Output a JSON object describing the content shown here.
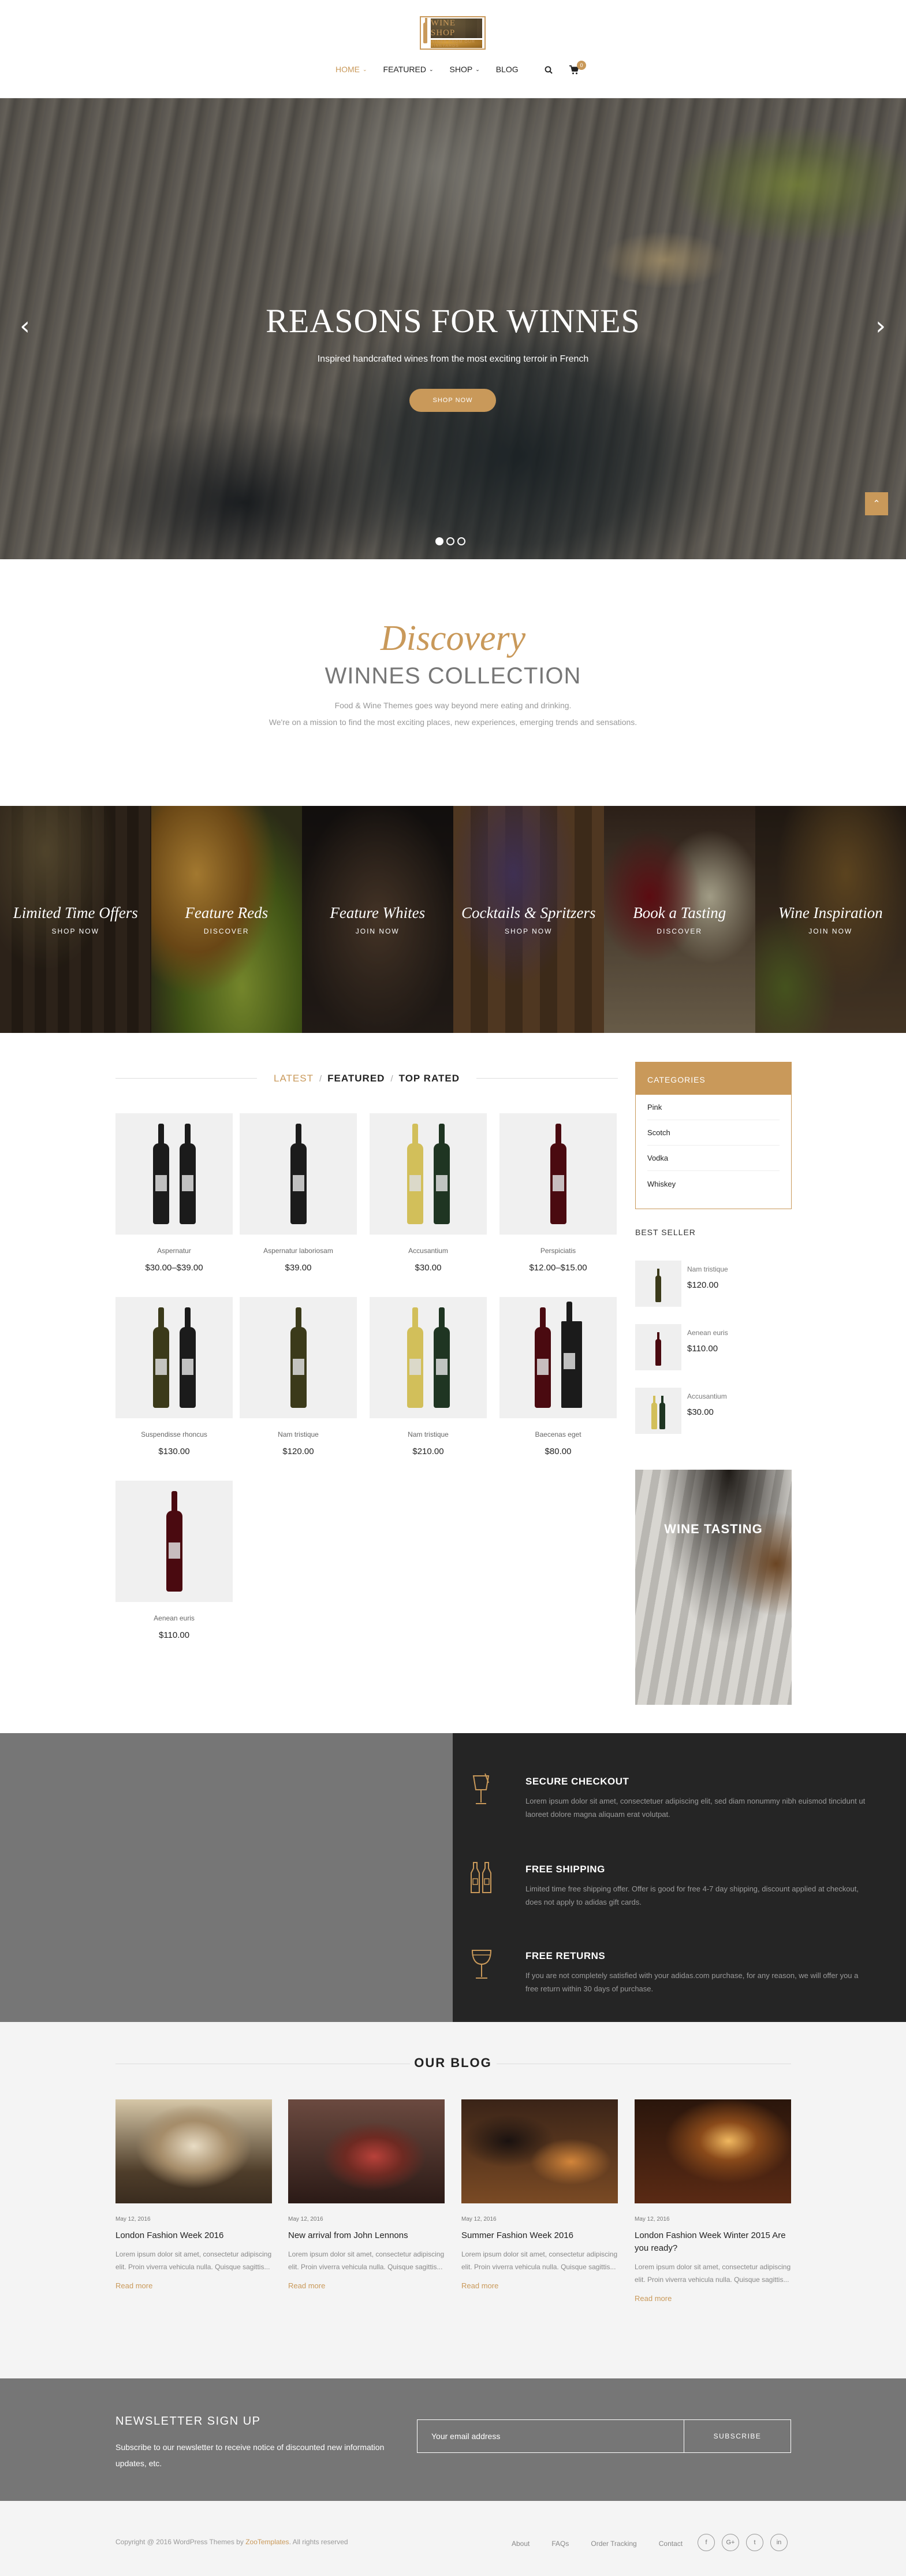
{
  "colors": {
    "accent": "#c9995a",
    "dark": "#252525",
    "gray": "#767676"
  },
  "header": {
    "logo_text": "WINE SHOP",
    "logo_tagline": "WINES FROM OUR VINEYARDS",
    "nav": [
      {
        "label": "HOME",
        "has_dropdown": true,
        "active": true
      },
      {
        "label": "FEATURED",
        "has_dropdown": true
      },
      {
        "label": "SHOP",
        "has_dropdown": true
      },
      {
        "label": "BLOG",
        "has_dropdown": false
      }
    ],
    "cart_count": "0"
  },
  "hero": {
    "title": "REASONS FOR WINNES",
    "subtitle": "Inspired handcrafted wines from the most exciting terroir in French",
    "button": "SHOP NOW",
    "prev": "‹",
    "next": "›",
    "back_to_top": "⌃"
  },
  "discovery": {
    "script": "Discovery",
    "title": "WINNES COLLECTION",
    "line1": "Food & Wine Themes goes way beyond mere eating and drinking.",
    "line2": "We're on a mission to find the most exciting places, new experiences, emerging trends and sensations."
  },
  "categories_strip": [
    {
      "title": "Limited Time Offers",
      "sub": "SHOP NOW"
    },
    {
      "title": "Feature Reds",
      "sub": "DISCOVER"
    },
    {
      "title": "Feature Whites",
      "sub": "JOIN NOW"
    },
    {
      "title": "Cocktails & Spritzers",
      "sub": "SHOP NOW"
    },
    {
      "title": "Book a Tasting",
      "sub": "DISCOVER"
    },
    {
      "title": "Wine Inspiration",
      "sub": "JOIN NOW"
    }
  ],
  "product_tabs": {
    "latest": "LATEST",
    "featured": "FEATURED",
    "top_rated": "TOP RATED",
    "sep": "/"
  },
  "products": [
    {
      "name": "Aspernatur",
      "price": "$30.00–$39.00"
    },
    {
      "name": "Aspernatur laboriosam",
      "price": "$39.00"
    },
    {
      "name": "Accusantium",
      "price": "$30.00"
    },
    {
      "name": "Perspiciatis",
      "price": "$12.00–$15.00"
    },
    {
      "name": "Suspendisse rhoncus",
      "price": "$130.00"
    },
    {
      "name": "Nam tristique",
      "price": "$120.00"
    },
    {
      "name": "Nam tristique",
      "price": "$210.00"
    },
    {
      "name": "Baecenas eget",
      "price": "$80.00"
    },
    {
      "name": "Aenean euris",
      "price": "$110.00"
    }
  ],
  "sidebar": {
    "categories_title": "CATEGORIES",
    "categories": [
      "Pink",
      "Scotch",
      "Vodka",
      "Whiskey"
    ],
    "best_seller_title": "BEST SELLER",
    "best_sellers": [
      {
        "name": "Nam tristique",
        "price": "$120.00"
      },
      {
        "name": "Aenean euris",
        "price": "$110.00"
      },
      {
        "name": "Accusantium",
        "price": "$30.00"
      }
    ],
    "promo_title": "WINE TASTING"
  },
  "services": [
    {
      "title": "SECURE CHECKOUT",
      "text": "Lorem ipsum dolor sit amet, consectetuer adipiscing elit, sed diam nonummy nibh euismod tincidunt ut laoreet dolore magna aliquam erat volutpat."
    },
    {
      "title": "FREE SHIPPING",
      "text": "Limited time free shipping offer. Offer is good for free 4-7 day shipping, discount applied at checkout, does not apply to adidas gift cards."
    },
    {
      "title": "FREE RETURNS",
      "text": "If you are not completely satisfied with your adidas.com purchase, for any reason, we will offer you a free return within 30 days of purchase."
    }
  ],
  "blog": {
    "title": "OUR BLOG",
    "posts": [
      {
        "date": "May 12, 2016",
        "title": "London Fashion Week 2016",
        "excerpt": "Lorem ipsum dolor sit amet, consectetur adipiscing elit. Proin viverra vehicula nulla. Quisque sagittis...",
        "more": "Read more"
      },
      {
        "date": "May 12, 2016",
        "title": "New arrival from John Lennons",
        "excerpt": "Lorem ipsum dolor sit amet, consectetur adipiscing elit. Proin viverra vehicula nulla. Quisque sagittis...",
        "more": "Read more"
      },
      {
        "date": "May 12, 2016",
        "title": "Summer Fashion Week 2016",
        "excerpt": "Lorem ipsum dolor sit amet, consectetur adipiscing elit. Proin viverra vehicula nulla. Quisque sagittis...",
        "more": "Read more"
      },
      {
        "date": "May 12, 2016",
        "title": "London Fashion Week Winter 2015 Are you ready?",
        "excerpt": "Lorem ipsum dolor sit amet, consectetur adipiscing elit. Proin viverra vehicula nulla. Quisque sagittis...",
        "more": "Read more"
      }
    ]
  },
  "newsletter": {
    "title": "NEWSLETTER SIGN UP",
    "text": "Subscribe to our newsletter to receive notice of discounted new information updates, etc.",
    "placeholder": "Your email address",
    "button": "SUBSCRIBE"
  },
  "footer": {
    "copyright_pre": "Copyright @ 2016 WordPress Themes by",
    "copyright_brand": "ZooTemplates",
    "copyright_post": ". All rights reserved",
    "links": [
      "About",
      "FAQs",
      "Order Tracking",
      "Contact"
    ],
    "socials": [
      "f",
      "G+",
      "t",
      "in"
    ]
  }
}
